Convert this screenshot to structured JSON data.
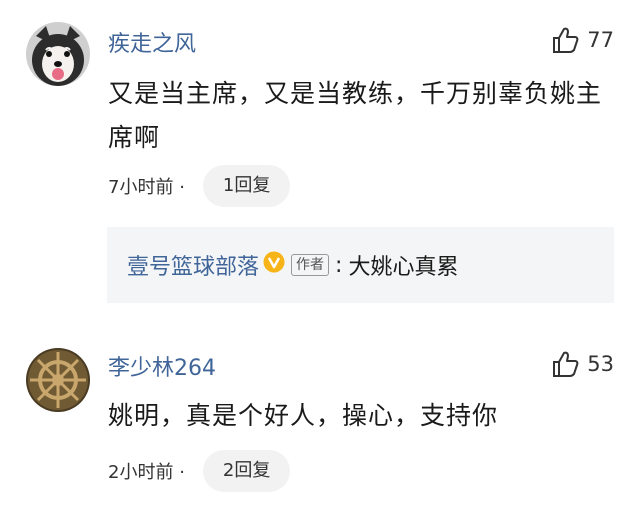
{
  "comments": [
    {
      "username": "疾走之风",
      "likes": "77",
      "text": "又是当主席，又是当教练，千万别辜负姚主席啊",
      "time": "7小时前",
      "dot": "·",
      "reply_count": "1回复",
      "avatar_icon": "dog-avatar-icon"
    },
    {
      "username": "李少林264",
      "likes": "53",
      "text": "姚明，真是个好人，操心，支持你",
      "time": "2小时前",
      "dot": "·",
      "reply_count": "2回复",
      "avatar_icon": "ship-wheel-avatar-icon"
    }
  ],
  "sub_reply": {
    "username": "壹号篮球部落",
    "verified_icon": "verified-v-icon",
    "author_tag": "作者",
    "separator": ":",
    "text": "大姚心真累"
  },
  "colors": {
    "username": "#406599",
    "verified_badge": "#f6b418",
    "reply_pill_bg": "#f2f2f2",
    "sub_reply_bg": "#f4f5f7"
  }
}
